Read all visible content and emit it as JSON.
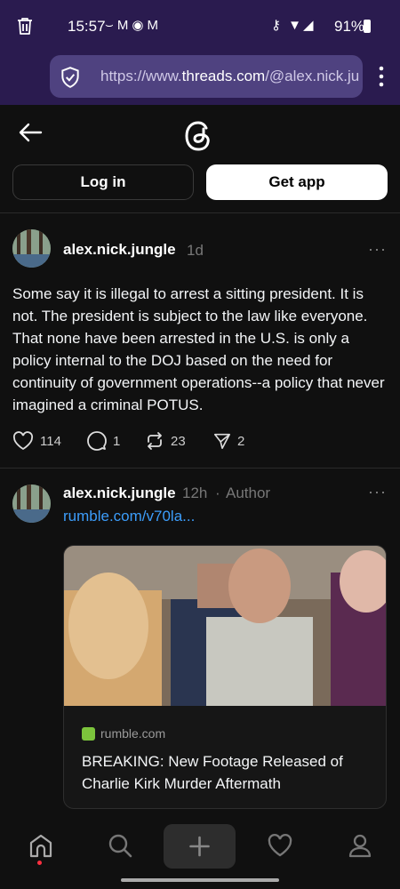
{
  "status_bar": {
    "time": "15:57",
    "notification_icons": [
      "whatsapp-icon",
      "gmail-icon",
      "app-icon",
      "gmail-icon"
    ],
    "system_icons": [
      "key-icon",
      "wifi-icon",
      "signal-icon"
    ],
    "battery": "91%"
  },
  "browser": {
    "url_prefix": "https://www.",
    "url_host": "threads.com",
    "url_path": "/@alex.nick.ju"
  },
  "header": {
    "login_label": "Log in",
    "getapp_label": "Get app"
  },
  "posts": [
    {
      "username": "alex.nick.jungle",
      "time": "1d",
      "text": "Some say it is illegal to arrest a sitting president. It is not. The president is subject to the law like everyone. That none have been arrested in the U.S. is only a policy internal to the DOJ based on the need for continuity of government operations--a policy that never imagined a criminal POTUS.",
      "likes": "114",
      "replies": "1",
      "reposts": "23",
      "shares": "2"
    },
    {
      "username": "alex.nick.jungle",
      "time": "12h",
      "separator": "·",
      "tag": "Author",
      "link": "rumble.com/v70la...",
      "card": {
        "domain": "rumble.com",
        "title": "BREAKING: New Footage Released of Charlie Kirk Murder Aftermath"
      }
    }
  ],
  "nav": {
    "items": [
      "home-icon",
      "search-icon",
      "new-post-icon",
      "activity-icon",
      "profile-icon"
    ],
    "active": "home-icon"
  },
  "colors": {
    "status_bg": "#2a1b4f",
    "url_box": "#4f4280",
    "background": "#101010",
    "link": "#3c9dfa",
    "notification_dot": "#ff3040"
  }
}
